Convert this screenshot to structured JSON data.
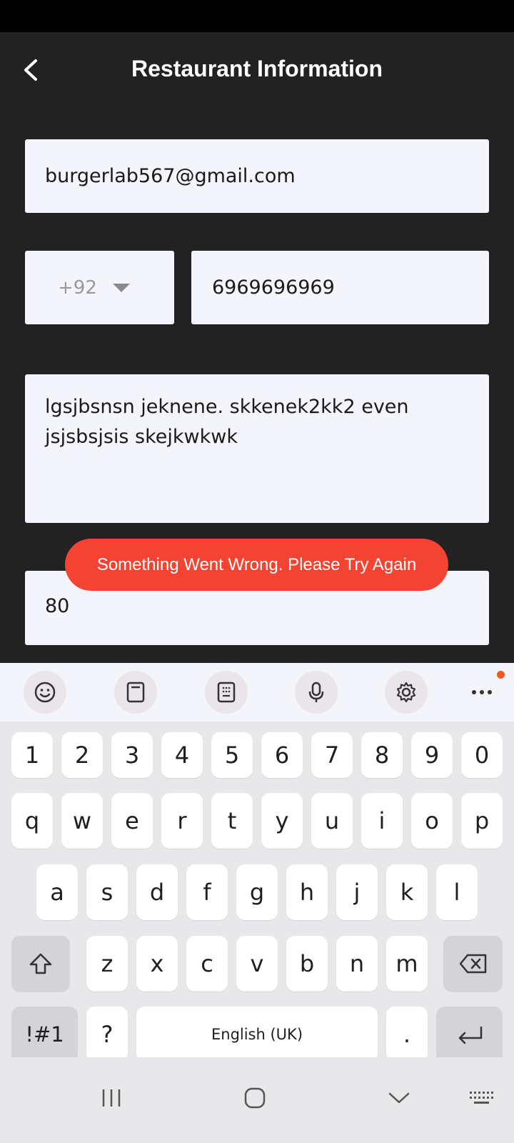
{
  "header": {
    "title": "Restaurant Information"
  },
  "form": {
    "email": "burgerlab567@gmail.com",
    "country_code": "+92",
    "phone": "6969696969",
    "description": "lgsjbsnsn jeknene. skkenek2kk2 even jsjsbsjsis skejkwkwk",
    "number": "80"
  },
  "toast": {
    "message": "Something Went Wrong. Please Try Again"
  },
  "keyboard": {
    "toolbar": [
      "emoji-icon",
      "clipboard-icon",
      "keypad-icon",
      "microphone-icon",
      "settings-icon",
      "more-icon"
    ],
    "row_numbers": [
      "1",
      "2",
      "3",
      "4",
      "5",
      "6",
      "7",
      "8",
      "9",
      "0"
    ],
    "row1": [
      "q",
      "w",
      "e",
      "r",
      "t",
      "y",
      "u",
      "i",
      "o",
      "p"
    ],
    "row2": [
      "a",
      "s",
      "d",
      "f",
      "g",
      "h",
      "j",
      "k",
      "l"
    ],
    "row3": [
      "z",
      "x",
      "c",
      "v",
      "b",
      "n",
      "m"
    ],
    "symbols_label": "!#1",
    "question_label": "?",
    "space_label": "English (UK)",
    "period_label": "."
  },
  "nav": [
    "recent-apps-icon",
    "home-icon",
    "back-down-icon",
    "keyboard-switch-icon"
  ],
  "colors": {
    "toast": "#f44333",
    "background": "#222222",
    "field": "#f4f5fc",
    "badge": "#f05a22"
  }
}
